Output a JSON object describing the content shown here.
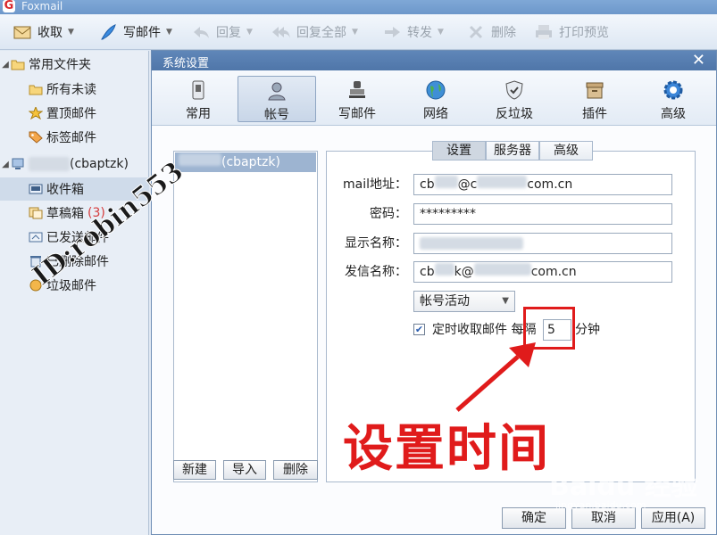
{
  "app": {
    "title": "Foxmail"
  },
  "toolbar": {
    "receive": "收取",
    "compose": "写邮件",
    "reply": "回复",
    "reply_all": "回复全部",
    "forward": "转发",
    "delete": "删除",
    "print_preview": "打印预览"
  },
  "folders": {
    "common": "常用文件夹",
    "unread": "所有未读",
    "pinned": "置顶邮件",
    "tagged": "标签邮件",
    "account_suffix": "(cbaptzk)",
    "inbox": "收件箱",
    "drafts": "草稿箱",
    "drafts_count": "(3)",
    "sent": "已发送邮件",
    "deleted": "已删除邮件",
    "junk": "垃圾邮件"
  },
  "dialog": {
    "title": "系统设置",
    "tabs": [
      "常用",
      "帐号",
      "写邮件",
      "网络",
      "反垃圾",
      "插件",
      "高级"
    ],
    "account_item_suffix": "(cbaptzk)",
    "subtabs": [
      "设置",
      "服务器",
      "高级"
    ],
    "fields": {
      "email_label": "mail地址：",
      "email_prefix": "cb",
      "email_mid": "@c",
      "email_suffix": "com.cn",
      "password_label": "密码：",
      "password_value": "*********",
      "display_name_label": "显示名称：",
      "sender_name_label": "发信名称：",
      "sender_prefix": "cb",
      "sender_mid": "k@",
      "sender_suffix": "com.cn"
    },
    "account_status": "帐号活动",
    "auto_receive_label": "定时收取邮件 每隔",
    "auto_receive_checked": true,
    "minutes_value": "5",
    "minutes_unit": "分钟",
    "buttons": {
      "new": "新建",
      "import": "导入",
      "delete": "删除",
      "ok": "确定",
      "cancel": "取消",
      "apply": "应用(A)"
    }
  },
  "annotation": {
    "text": "设置时间",
    "color": "#e01b1b"
  },
  "watermarks": {
    "user": "ID:robin553",
    "brand": "Baidu 经验",
    "brand_url": "jingyan.baidu.com"
  }
}
